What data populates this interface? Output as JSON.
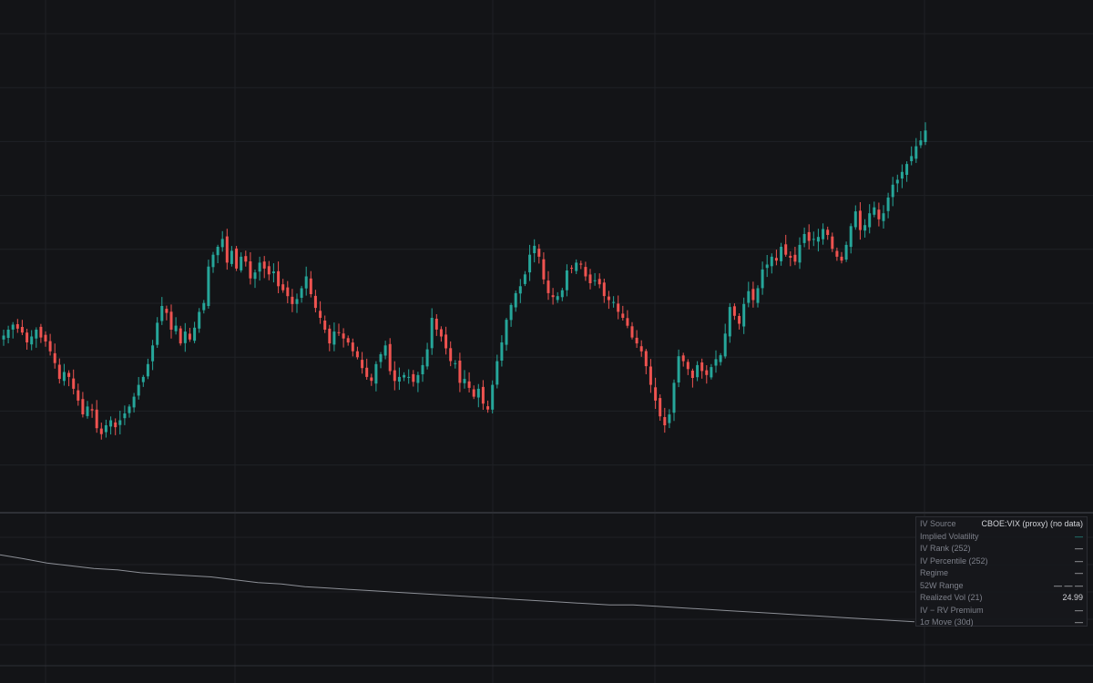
{
  "theme": {
    "background": "#131417",
    "grid": "#1f2126",
    "separator": "#2e3036",
    "up_color": "#26a69a",
    "down_color": "#ef5350",
    "line_color": "#8c8f96"
  },
  "info_panel": {
    "rows": [
      {
        "label": "IV Source",
        "value": "CBOE:VIX (proxy) (no data)"
      },
      {
        "label": "Implied Volatility",
        "value": "—"
      },
      {
        "label": "IV Rank (252)",
        "value": "—"
      },
      {
        "label": "IV Percentile (252)",
        "value": "—"
      },
      {
        "label": "Regime",
        "value": "—"
      },
      {
        "label": "52W Range",
        "value": "— — —"
      },
      {
        "label": "Realized Vol (21)",
        "value": "24.99"
      },
      {
        "label": "IV − RV Premium",
        "value": "—"
      },
      {
        "label": "1σ Move (30d)",
        "value": "—"
      }
    ]
  },
  "chart_data": [
    {
      "type": "candlestick",
      "title": "",
      "xlabel": "",
      "ylabel": "",
      "series": [
        {
          "kind": "close",
          "values": [
            312,
            318,
            323,
            319,
            315,
            305,
            311,
            318,
            310,
            306,
            296,
            284,
            268,
            275,
            270,
            258,
            246,
            232,
            240,
            236,
            218,
            212,
            221,
            226,
            219,
            226,
            233,
            240,
            250,
            262,
            270,
            283,
            302,
            325,
            342,
            335,
            318,
            322,
            304,
            316,
            308,
            320,
            336,
            345,
            382,
            394,
            402,
            410,
            386,
            398,
            380,
            392,
            387,
            370,
            376,
            386,
            380,
            374,
            377,
            362,
            358,
            352,
            344,
            349,
            360,
            372,
            354,
            340,
            330,
            318,
            304,
            316,
            315,
            309,
            305,
            296,
            290,
            279,
            270,
            266,
            283,
            293,
            302,
            276,
            266,
            270,
            272,
            270,
            265,
            272,
            282,
            298,
            330,
            318,
            311,
            299,
            286,
            284,
            264,
            268,
            259,
            250,
            258,
            243,
            237,
            262,
            286,
            305,
            328,
            343,
            355,
            362,
            374,
            394,
            403,
            392,
            369,
            355,
            351,
            352,
            358,
            378,
            380,
            386,
            384,
            372,
            365,
            368,
            364,
            352,
            348,
            346,
            336,
            330,
            322,
            310,
            304,
            296,
            281,
            262,
            246,
            230,
            221,
            232,
            264,
            291,
            286,
            278,
            269,
            282,
            276,
            272,
            280,
            288,
            292,
            314,
            341,
            332,
            324,
            344,
            357,
            348,
            360,
            379,
            384,
            392,
            388,
            402,
            394,
            391,
            387,
            404,
            415,
            408,
            410,
            412,
            420,
            414,
            400,
            392,
            388,
            404,
            423,
            438,
            419,
            424,
            436,
            442,
            430,
            436,
            452,
            465,
            470,
            478,
            486,
            494,
            504,
            510,
            520
          ]
        }
      ],
      "grid": true
    },
    {
      "type": "line",
      "title": "",
      "xlabel": "",
      "ylabel": "",
      "series": [
        {
          "name": "",
          "values": [
            24.99,
            24.85,
            24.7,
            24.6,
            24.5,
            24.45,
            24.35,
            24.3,
            24.25,
            24.2,
            24.1,
            24.0,
            23.95,
            23.85,
            23.8,
            23.75,
            23.7,
            23.65,
            23.6,
            23.55,
            23.5,
            23.45,
            23.4,
            23.35,
            23.3,
            23.25,
            23.2,
            23.2,
            23.15,
            23.1,
            23.05,
            23.0,
            22.95,
            22.9,
            22.85,
            22.8,
            22.75,
            22.7,
            22.65,
            22.6
          ]
        }
      ],
      "grid": true
    }
  ]
}
